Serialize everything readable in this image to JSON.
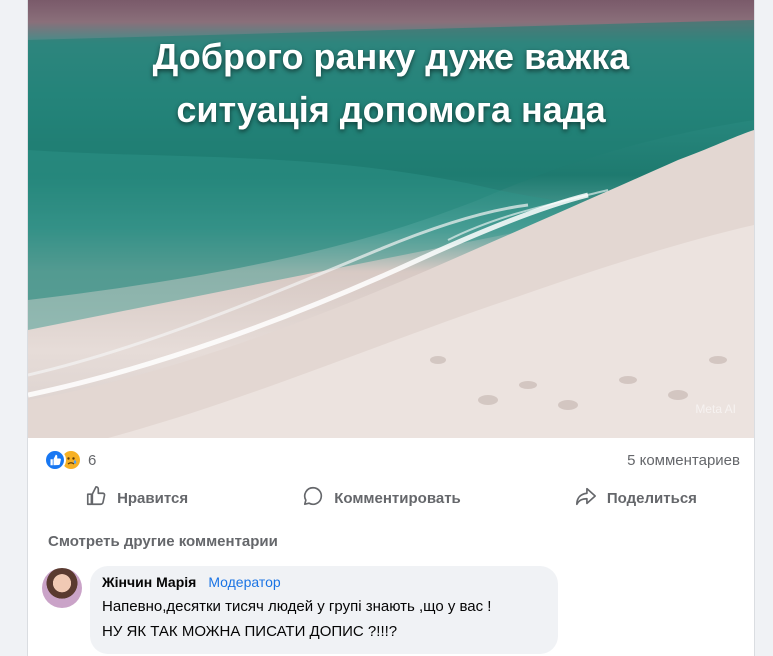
{
  "post": {
    "image_text_line1": "Доброго ранку дуже важка",
    "image_text_line2": "ситуація допомога нада",
    "watermark": "Meta AI"
  },
  "stats": {
    "reaction_count": "6",
    "comments_label": "5 комментариев"
  },
  "actions": {
    "like_label": "Нравится",
    "comment_label": "Комментировать",
    "share_label": "Поделиться"
  },
  "comments": {
    "see_more_label": "Смотреть другие комментарии",
    "items": [
      {
        "author": "Жінчин Марія",
        "role": "Модератор",
        "line1": "Напевно,десятки тисяч людей у групі знають ,що у вас !",
        "line2": "НУ ЯК ТАК МОЖНА ПИСАТИ ДОПИС ?!!!?"
      }
    ]
  },
  "colors": {
    "accent": "#1877f2",
    "muted_text": "#65676b",
    "moderator": "#1b74e4"
  }
}
